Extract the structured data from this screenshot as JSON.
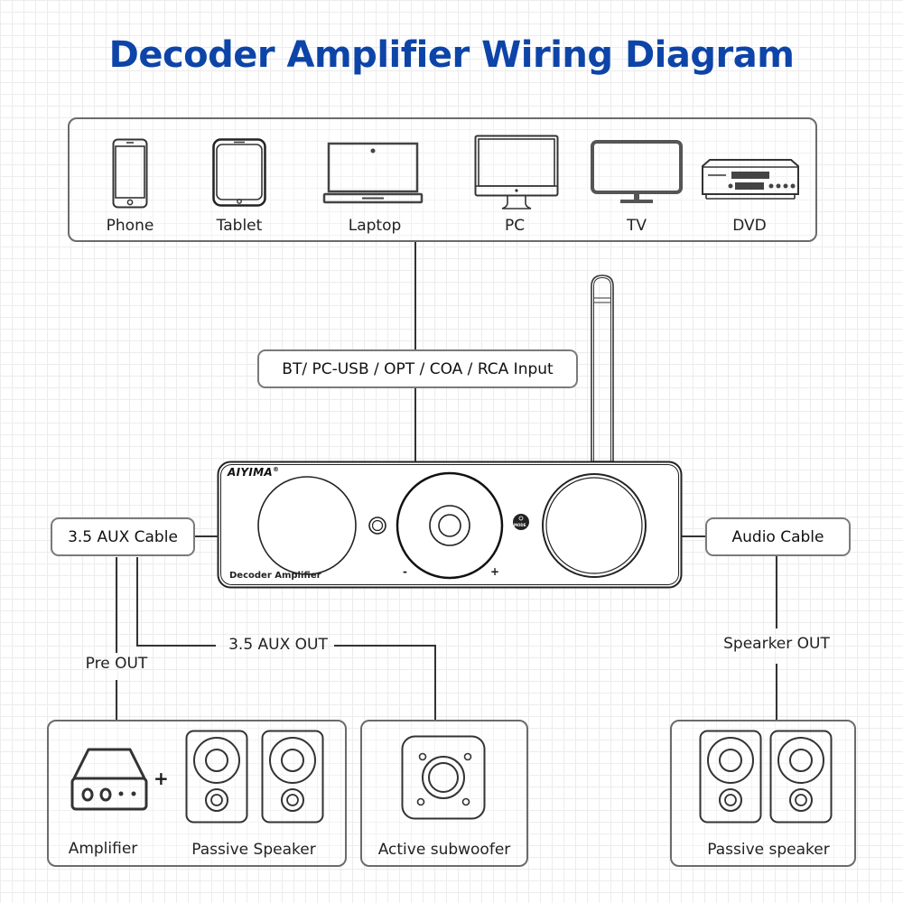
{
  "title": "Decoder Amplifier Wiring Diagram",
  "colors": {
    "title": "#0d44a8",
    "line": "#333333",
    "box_border": "#6b6b6b"
  },
  "sources": {
    "items": [
      {
        "label": "Phone",
        "icon": "phone-icon"
      },
      {
        "label": "Tablet",
        "icon": "tablet-icon"
      },
      {
        "label": "Laptop",
        "icon": "laptop-icon"
      },
      {
        "label": "PC",
        "icon": "desktop-monitor-icon"
      },
      {
        "label": "TV",
        "icon": "tv-icon"
      },
      {
        "label": "DVD",
        "icon": "dvd-player-icon"
      }
    ]
  },
  "input_label": "BT/ PC-USB / OPT / COA / RCA Input",
  "amplifier": {
    "brand": "AIYIMA",
    "registered": "®",
    "model_label": "Decoder Amplifier",
    "minus": "-",
    "plus": "+",
    "mode_button": "MODE"
  },
  "left_cable": "3.5 AUX Cable",
  "right_cable": "Audio Cable",
  "pre_out": "Pre OUT",
  "aux_out": "3.5 AUX OUT",
  "speaker_out": "Spearker OUT",
  "outputs": {
    "amp_combo": {
      "amplifier": "Amplifier",
      "plus": "+",
      "speaker": "Passive Speaker"
    },
    "subwoofer": "Active subwoofer",
    "passive": "Passive speaker"
  }
}
